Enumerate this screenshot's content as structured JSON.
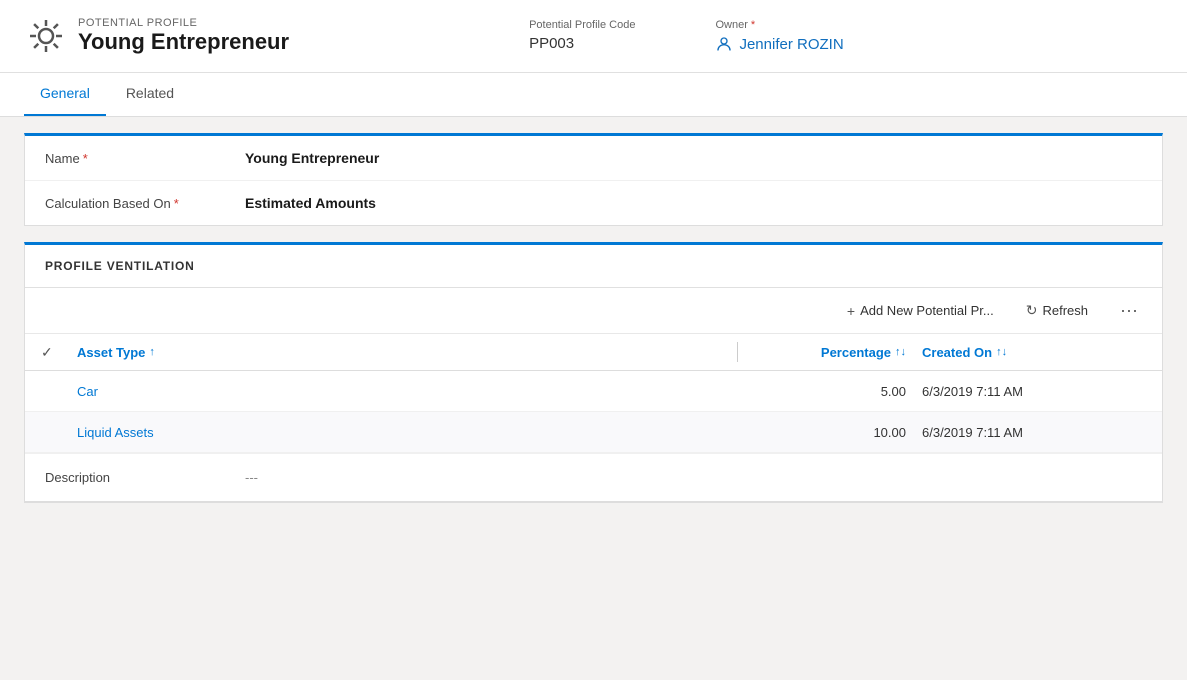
{
  "header": {
    "subtitle": "POTENTIAL PROFILE",
    "title": "Young Entrepreneur",
    "code_label": "Potential Profile Code",
    "code_value": "PP003",
    "owner_label": "Owner",
    "owner_required": "*",
    "owner_name": "Jennifer ROZIN"
  },
  "tabs": [
    {
      "id": "general",
      "label": "General",
      "active": true
    },
    {
      "id": "related",
      "label": "Related",
      "active": false
    }
  ],
  "form": {
    "fields": [
      {
        "label": "Name",
        "required": true,
        "value": "Young Entrepreneur"
      },
      {
        "label": "Calculation Based On",
        "required": true,
        "value": "Estimated Amounts"
      }
    ]
  },
  "profile_ventilation": {
    "section_title": "PROFILE VENTILATION",
    "toolbar": {
      "add_label": "Add New Potential Pr...",
      "refresh_label": "Refresh"
    },
    "columns": [
      {
        "id": "asset_type",
        "label": "Asset Type"
      },
      {
        "id": "percentage",
        "label": "Percentage"
      },
      {
        "id": "created_on",
        "label": "Created On"
      }
    ],
    "rows": [
      {
        "asset_type": "Car",
        "percentage": "5.00",
        "created_on": "6/3/2019 7:11 AM"
      },
      {
        "asset_type": "Liquid Assets",
        "percentage": "10.00",
        "created_on": "6/3/2019 7:11 AM"
      }
    ]
  },
  "description": {
    "label": "Description",
    "value": "---"
  },
  "icons": {
    "sort_updown": "↑↓",
    "sort_up": "↑",
    "add": "+",
    "refresh": "↻",
    "more": "···",
    "checkmark": "✓",
    "person": "👤"
  },
  "colors": {
    "accent": "#0078d4",
    "required": "#d0342c",
    "link": "#106ebe"
  }
}
